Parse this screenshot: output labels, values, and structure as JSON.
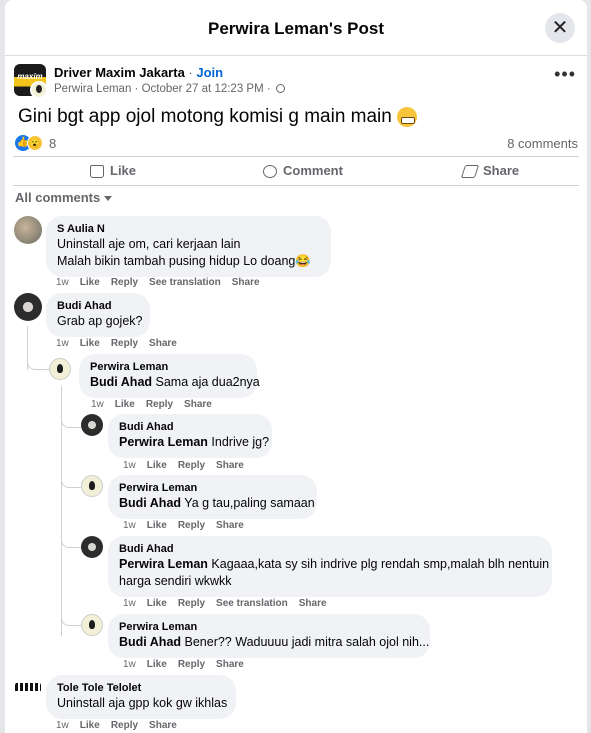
{
  "header": {
    "title": "Perwira Leman's Post",
    "close": "✕"
  },
  "post": {
    "group_name": "Driver Maxim Jakarta",
    "group_logo_text": "maxim",
    "separator": " · ",
    "join_label": "Join",
    "author": "Perwira Leman",
    "date": " · October 27 at 12:23 PM · ",
    "more": "•••",
    "text": "Gini bgt app ojol motong komisi g main main ",
    "reaction_count": "8",
    "comment_count": "8 comments"
  },
  "actions": {
    "like": "Like",
    "comment": "Comment",
    "share": "Share"
  },
  "filter_label": "All comments",
  "comments": [
    {
      "author": "S Aulia N",
      "lines": [
        "Uninstall aje om, cari kerjaan lain",
        "Malah bikin tambah pusing hidup Lo doang😂"
      ],
      "time": "1w",
      "like": "Like",
      "reply": "Reply",
      "translate": "See translation",
      "share": "Share"
    },
    {
      "author": "Budi Ahad",
      "text": "Grab ap gojek?",
      "time": "1w",
      "like": "Like",
      "reply": "Reply",
      "share": "Share"
    },
    {
      "author": "Perwira Leman",
      "mention": "Budi Ahad",
      "text": " Sama aja dua2nya",
      "time": "1w",
      "like": "Like",
      "reply": "Reply",
      "share": "Share"
    },
    {
      "author": "Budi Ahad",
      "mention": "Perwira Leman",
      "text": " Indrive jg?",
      "time": "1w",
      "like": "Like",
      "reply": "Reply",
      "share": "Share"
    },
    {
      "author": "Perwira Leman",
      "mention": "Budi Ahad",
      "text": " Ya g tau,paling samaan",
      "time": "1w",
      "like": "Like",
      "reply": "Reply",
      "share": "Share"
    },
    {
      "author": "Budi Ahad",
      "mention": "Perwira Leman",
      "text": " Kagaaa,kata sy sih indrive plg rendah smp,malah blh nentuin",
      "text2": "harga sendiri wkwkk",
      "time": "1w",
      "like": "Like",
      "reply": "Reply",
      "translate": "See translation",
      "share": "Share"
    },
    {
      "author": "Perwira Leman",
      "mention": "Budi Ahad",
      "text": " Bener?? Waduuuu jadi mitra salah ojol nih...",
      "time": "1w",
      "like": "Like",
      "reply": "Reply",
      "share": "Share"
    },
    {
      "author": "Tole Tole Telolet",
      "text": "Uninstall aja gpp kok gw ikhlas",
      "time": "1w",
      "like": "Like",
      "reply": "Reply",
      "share": "Share"
    }
  ]
}
